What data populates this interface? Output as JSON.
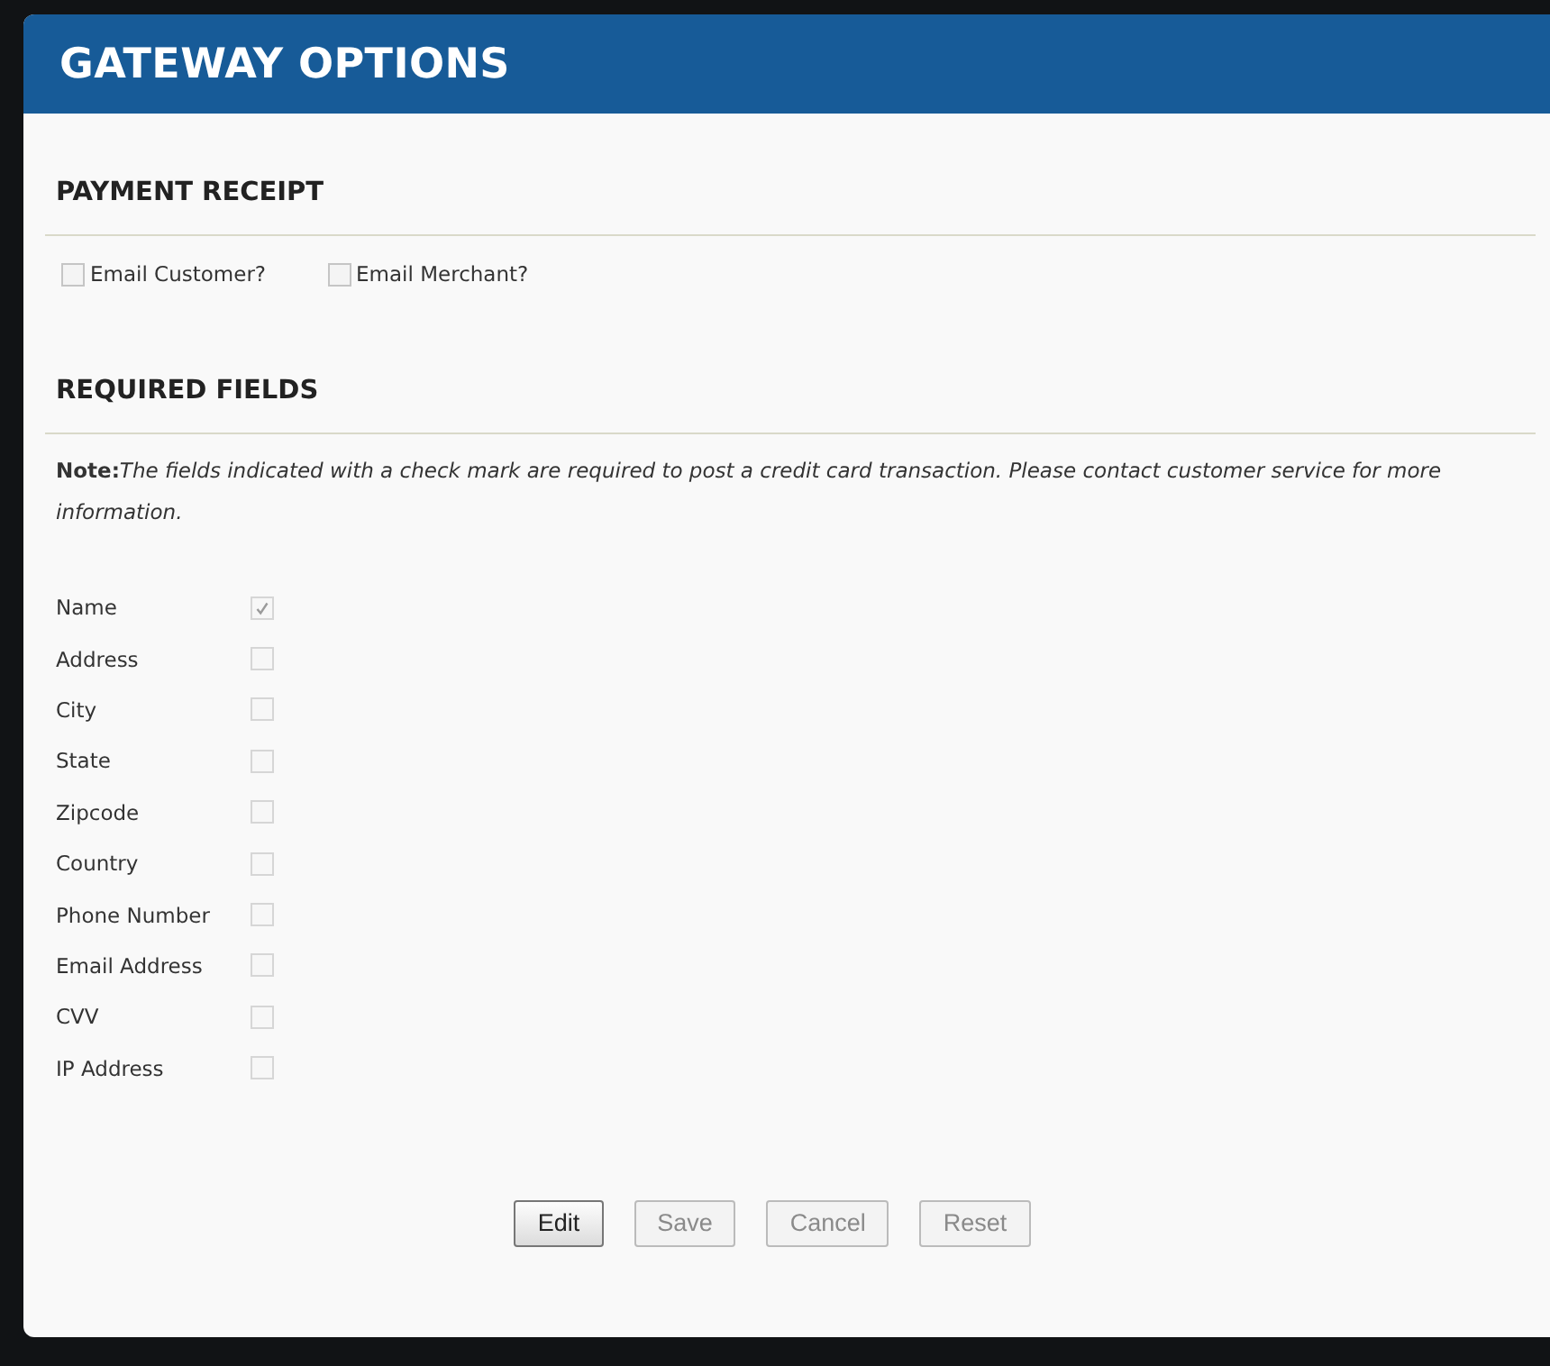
{
  "window": {
    "title": "GATEWAY OPTIONS"
  },
  "payment_receipt": {
    "heading": "PAYMENT RECEIPT",
    "options": [
      {
        "label": "Email Customer?",
        "checked": false
      },
      {
        "label": "Email Merchant?",
        "checked": false
      }
    ]
  },
  "required_fields": {
    "heading": "REQUIRED FIELDS",
    "note": "**Note:**The fields indicated with a check mark are required to post a credit card transaction. Please contact customer service for more information.",
    "fields": [
      {
        "label": "Name",
        "checked": true,
        "disabled": true
      },
      {
        "label": "Address",
        "checked": false,
        "disabled": true
      },
      {
        "label": "City",
        "checked": false,
        "disabled": true
      },
      {
        "label": "State",
        "checked": false,
        "disabled": true
      },
      {
        "label": "Zipcode",
        "checked": false,
        "disabled": true
      },
      {
        "label": "Country",
        "checked": false,
        "disabled": true
      },
      {
        "label": "Phone Number",
        "checked": false,
        "disabled": true
      },
      {
        "label": "Email Address",
        "checked": false,
        "disabled": true
      },
      {
        "label": "CVV",
        "checked": false,
        "disabled": true
      },
      {
        "label": "IP Address",
        "checked": false,
        "disabled": true
      }
    ]
  },
  "buttons": [
    {
      "label": "Edit",
      "disabled": false
    },
    {
      "label": "Save",
      "disabled": true
    },
    {
      "label": "Cancel",
      "disabled": true
    },
    {
      "label": "Reset",
      "disabled": true
    }
  ]
}
